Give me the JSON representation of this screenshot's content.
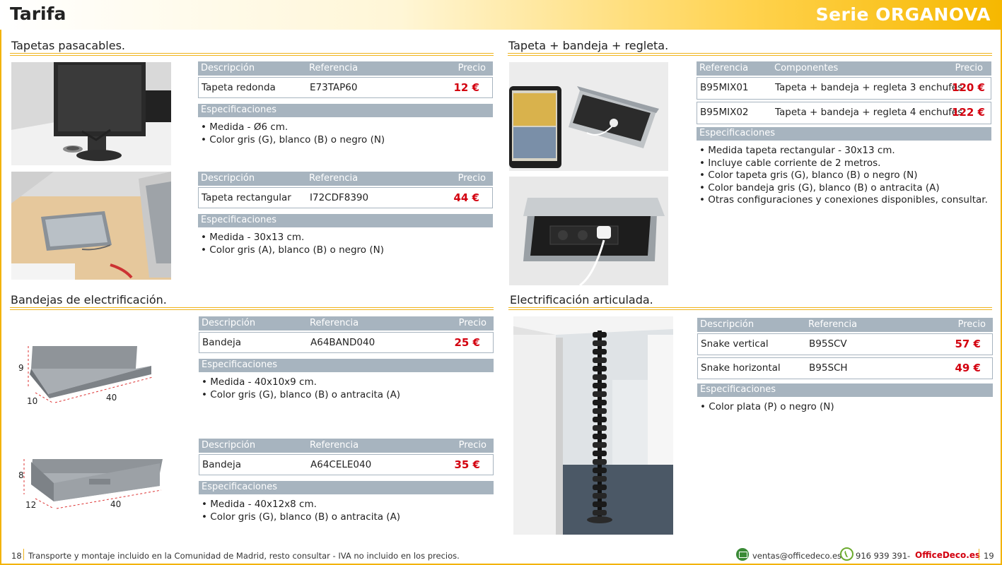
{
  "header": {
    "title": "Tarifa",
    "serie": "Serie ORGANOVA"
  },
  "labels": {
    "descripcion": "Descripción",
    "referencia": "Referencia",
    "precio": "Precio",
    "componentes": "Componentes",
    "especificaciones": "Especificaciones"
  },
  "sections": {
    "tapetas": {
      "title": "Tapetas pasacables.",
      "products": [
        {
          "desc": "Tapeta redonda",
          "ref": "E73TAP60",
          "price": "12 €",
          "specs": [
            "Medida - Ø6 cm.",
            "Color gris (G), blanco (B) o negro (N)"
          ]
        },
        {
          "desc": "Tapeta rectangular",
          "ref": "I72CDF8390",
          "price": "44 €",
          "specs": [
            "Medida - 30x13 cm.",
            "Color gris (A), blanco (B) o negro (N)"
          ]
        }
      ]
    },
    "tapeta_bandeja": {
      "title": "Tapeta + bandeja + regleta.",
      "rows": [
        {
          "ref": "B95MIX01",
          "comp": "Tapeta + bandeja + regleta 3 enchufes",
          "price": "120 €"
        },
        {
          "ref": "B95MIX02",
          "comp": "Tapeta + bandeja + regleta 4 enchufes",
          "price": "122 €"
        }
      ],
      "specs": [
        "Medida tapeta rectangular - 30x13 cm.",
        "Incluye cable corriente de 2 metros.",
        "Color tapeta gris (G), blanco (B) o negro (N)",
        "Color bandeja gris (G), blanco (B) o antracita (A)",
        "Otras configuraciones y conexiones disponibles, consultar."
      ]
    },
    "bandejas": {
      "title": "Bandejas de electrificación.",
      "products": [
        {
          "desc": "Bandeja",
          "ref": "A64BAND040",
          "price": "25 €",
          "specs": [
            "Medida - 40x10x9 cm.",
            "Color gris (G), blanco (B) o antracita (A)"
          ],
          "dims": {
            "h": "9",
            "d": "10",
            "w": "40"
          }
        },
        {
          "desc": "Bandeja",
          "ref": "A64CELE040",
          "price": "35 €",
          "specs": [
            "Medida - 40x12x8 cm.",
            "Color gris (G), blanco (B) o antracita (A)"
          ],
          "dims": {
            "h": "8",
            "d": "12",
            "w": "40"
          }
        }
      ]
    },
    "articulada": {
      "title": "Electrificación articulada.",
      "rows": [
        {
          "desc": "Snake vertical",
          "ref": "B95SCV",
          "price": "57 €"
        },
        {
          "desc": "Snake horizontal",
          "ref": "B95SCH",
          "price": "49 €"
        }
      ],
      "specs": [
        "Color plata (P) o negro (N)"
      ]
    }
  },
  "footer": {
    "page_left": "18",
    "page_right": "19",
    "note": "Transporte y montaje incluido en la Comunidad de Madrid, resto consultar - IVA no incluido en los precios.",
    "email": "ventas@officedeco.es",
    "phone": "916 939 391",
    "dash": "-",
    "brand": "OfficeDeco.es"
  },
  "colors": {
    "accent": "#f3b300",
    "table_header": "#a7b4bf",
    "price": "#d3000f"
  }
}
